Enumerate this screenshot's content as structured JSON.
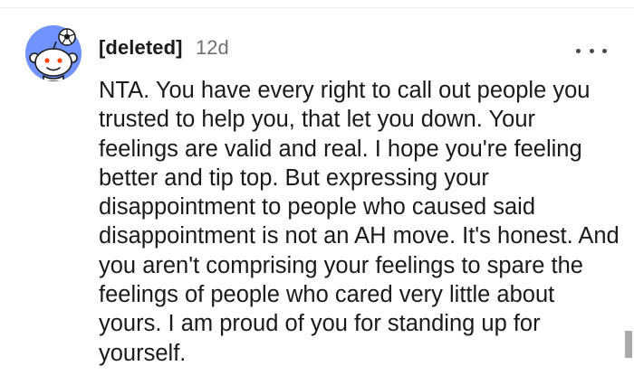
{
  "comment": {
    "username": "[deleted]",
    "timestamp": "12d",
    "more_icon": "more-horizontal-icon",
    "avatar_icon": "snoo-avatar-icon",
    "body": "NTA. You have every right to call out people you trusted to help you, that let you down. Your feelings are valid and real. I hope you're feeling better and tip top. But expressing your disappointment to people who caused said disappointment is not an AH move. It's honest. And you aren't comprising your feelings to spare the feelings of people who cared very little about yours. I am proud of you for standing up for yourself."
  },
  "colors": {
    "avatar_bg": "#7193ff",
    "text": "#1a1a1b",
    "muted": "#6f6f6f"
  }
}
